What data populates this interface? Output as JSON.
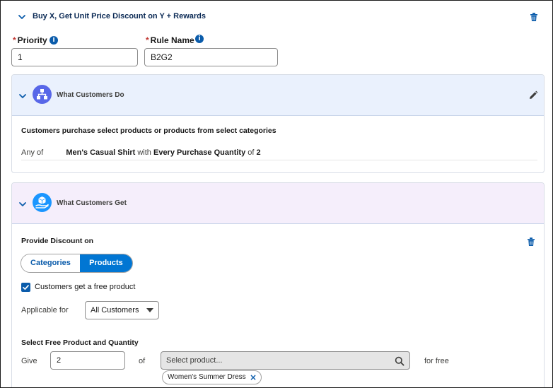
{
  "rule": {
    "title": "Buy X, Get Unit Price Discount on Y + Rewards"
  },
  "fields": {
    "priority_label": "Priority",
    "priority_value": "1",
    "rule_name_label": "Rule Name",
    "rule_name_value": "B2G2",
    "required_mark": "*",
    "info_glyph": "i"
  },
  "customers_do": {
    "title": "What Customers Do",
    "description": "Customers purchase select products or products from select categories",
    "condition": {
      "prefix": "Any of",
      "product": "Men's Casual Shirt",
      "with": "with",
      "quantity_label": "Every Purchase Quantity",
      "of": "of",
      "quantity": "2"
    }
  },
  "customers_get": {
    "title": "What Customers Get",
    "discount_label": "Provide Discount on",
    "toggle": {
      "categories": "Categories",
      "products": "Products",
      "selected": "Products"
    },
    "free_product_checkbox": "Customers get a free product",
    "applicable_label": "Applicable for",
    "applicable_value": "All Customers",
    "select_section_label": "Select Free Product and Quantity",
    "give_label": "Give",
    "give_value": "2",
    "of_label": "of",
    "product_search_placeholder": "Select product...",
    "for_free_label": "for free",
    "selected_product": "Women's Summer Dress"
  },
  "colors": {
    "brand_blue": "#0176d3",
    "link_blue": "#0b5cab",
    "do_header_bg": "#eaf1fd",
    "get_header_bg": "#f5eefb",
    "do_icon_bg": "#5867e8",
    "get_icon_bg": "#1b96ff"
  }
}
